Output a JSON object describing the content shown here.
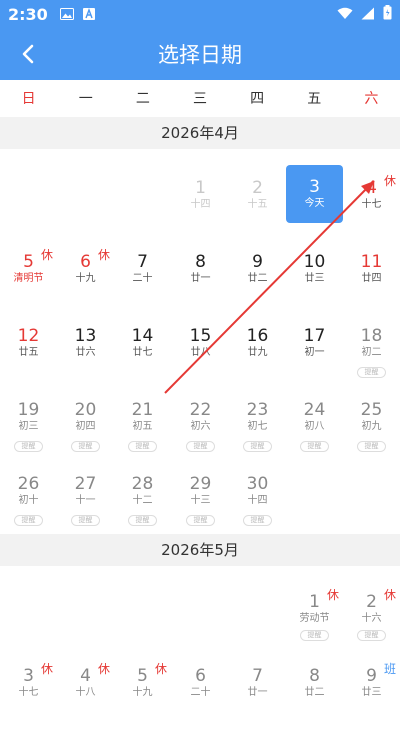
{
  "status_bar": {
    "time": "2:30"
  },
  "app_bar": {
    "title": "选择日期"
  },
  "weekdays": [
    "日",
    "一",
    "二",
    "三",
    "四",
    "五",
    "六"
  ],
  "months": [
    {
      "title": "2026年4月"
    },
    {
      "title": "2026年5月"
    }
  ],
  "days": {
    "apr1": {
      "day": "1",
      "sub": "十四"
    },
    "apr2": {
      "day": "2",
      "sub": "十五"
    },
    "apr3": {
      "day": "3",
      "sub": "今天"
    },
    "apr4": {
      "day": "4",
      "sub": "十七",
      "tag": "休"
    },
    "apr5": {
      "day": "5",
      "sub": "清明节",
      "tag": "休"
    },
    "apr6": {
      "day": "6",
      "sub": "十九",
      "tag": "休"
    },
    "apr7": {
      "day": "7",
      "sub": "二十"
    },
    "apr8": {
      "day": "8",
      "sub": "廿一"
    },
    "apr9": {
      "day": "9",
      "sub": "廿二"
    },
    "apr10": {
      "day": "10",
      "sub": "廿三"
    },
    "apr11": {
      "day": "11",
      "sub": "廿四"
    },
    "apr12": {
      "day": "12",
      "sub": "廿五"
    },
    "apr13": {
      "day": "13",
      "sub": "廿六"
    },
    "apr14": {
      "day": "14",
      "sub": "廿七"
    },
    "apr15": {
      "day": "15",
      "sub": "廿八"
    },
    "apr16": {
      "day": "16",
      "sub": "廿九"
    },
    "apr17": {
      "day": "17",
      "sub": "初一"
    },
    "apr18": {
      "day": "18",
      "sub": "初二"
    },
    "apr19": {
      "day": "19",
      "sub": "初三"
    },
    "apr20": {
      "day": "20",
      "sub": "初四"
    },
    "apr21": {
      "day": "21",
      "sub": "初五"
    },
    "apr22": {
      "day": "22",
      "sub": "初六"
    },
    "apr23": {
      "day": "23",
      "sub": "初七"
    },
    "apr24": {
      "day": "24",
      "sub": "初八"
    },
    "apr25": {
      "day": "25",
      "sub": "初九"
    },
    "apr26": {
      "day": "26",
      "sub": "初十"
    },
    "apr27": {
      "day": "27",
      "sub": "十一"
    },
    "apr28": {
      "day": "28",
      "sub": "十二"
    },
    "apr29": {
      "day": "29",
      "sub": "十三"
    },
    "apr30": {
      "day": "30",
      "sub": "十四"
    },
    "may1": {
      "day": "1",
      "sub": "劳动节",
      "tag": "休"
    },
    "may2": {
      "day": "2",
      "sub": "十六",
      "tag": "休"
    },
    "may3": {
      "day": "3",
      "sub": "十七",
      "tag": "休"
    },
    "may4": {
      "day": "4",
      "sub": "十八",
      "tag": "休"
    },
    "may5": {
      "day": "5",
      "sub": "十九",
      "tag": "休"
    },
    "may6": {
      "day": "6",
      "sub": "二十"
    },
    "may7": {
      "day": "7",
      "sub": "廿一"
    },
    "may8": {
      "day": "8",
      "sub": "廿二"
    },
    "may9": {
      "day": "9",
      "sub": "廿三",
      "tag": "班"
    }
  },
  "remind_label": "提醒",
  "colors": {
    "accent": "#4a98f2",
    "holiday": "#e53935",
    "annotation_arrow": "#e53935"
  }
}
